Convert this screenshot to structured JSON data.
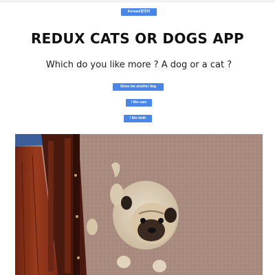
{
  "language_button": {
    "label": "Korean/한국어"
  },
  "header": {
    "title": "REDUX CATS OR DOGS APP",
    "question": "Which do you like more ? A dog or a cat ?"
  },
  "actions": {
    "show_another_dog": "Show me another dog",
    "like_cats": "I like cats",
    "like_both": "I like both"
  },
  "colors": {
    "button_bg": "#4a86e8",
    "button_text": "#ffffff"
  },
  "photo": {
    "icon": "pug-photo"
  }
}
